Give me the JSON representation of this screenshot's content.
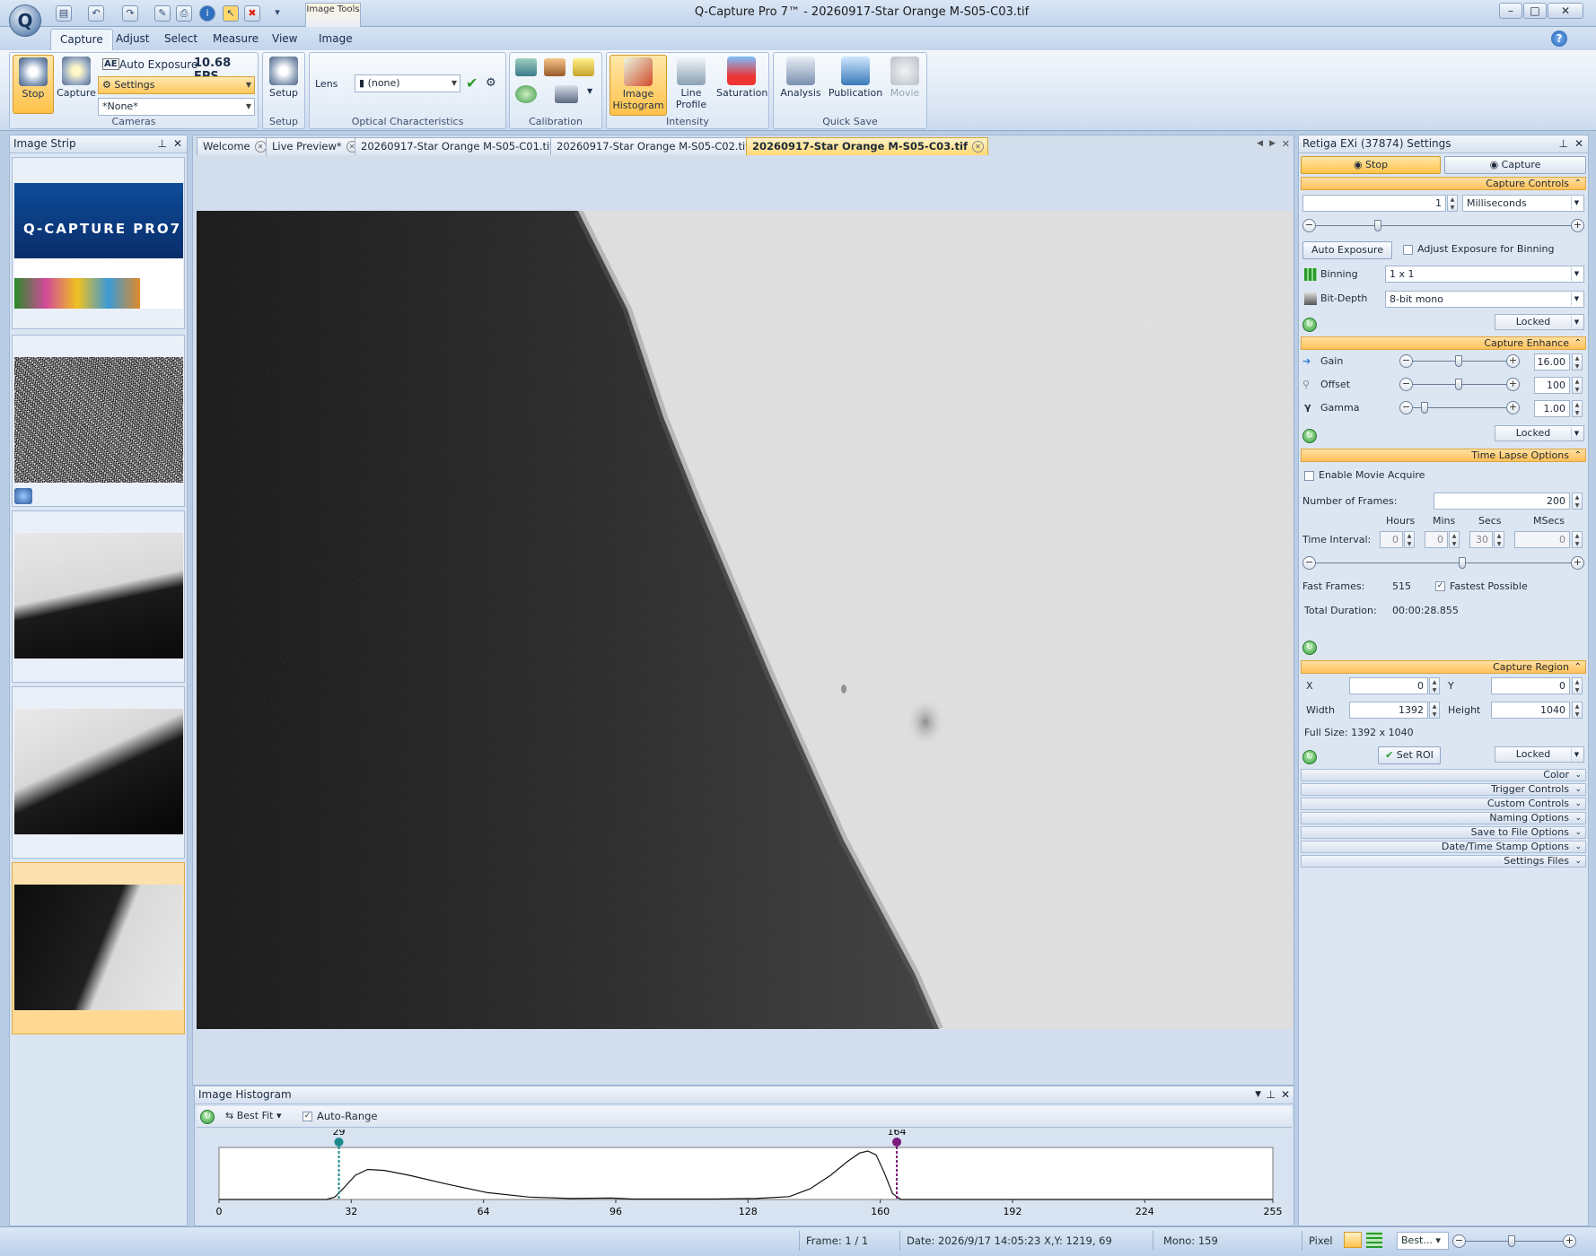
{
  "window": {
    "title": "Q-Capture Pro 7™ - 20260917-Star Orange M-S05-C03.tif",
    "context_tab": "Image Tools",
    "logo": "Q"
  },
  "ribbon_tabs": [
    "Capture",
    "Adjust",
    "Select",
    "Measure",
    "View",
    "Image"
  ],
  "ribbon": {
    "cameras": {
      "stop": "Stop",
      "capture": "Capture",
      "auto_exposure": "Auto Exposure",
      "ae_badge": "AE",
      "fps": "10.68 FPS",
      "settings": "Settings",
      "preset": "*None*",
      "label": "Cameras"
    },
    "setup": {
      "button": "Setup",
      "label": "Setup"
    },
    "optical": {
      "lens_label": "Lens",
      "lens_value": "(none)",
      "label": "Optical Characteristics"
    },
    "calibration": {
      "label": "Calibration"
    },
    "intensity": {
      "histogram": "Image Histogram",
      "line_profile": "Line Profile",
      "saturation": "Saturation",
      "label": "Intensity"
    },
    "quicksave": {
      "analysis": "Analysis",
      "publication": "Publication",
      "movie": "Movie",
      "label": "Quick Save"
    }
  },
  "image_strip": {
    "title": "Image Strip",
    "splash_title": "Q-CAPTURE PRO7"
  },
  "doc_tabs": [
    {
      "label": "Welcome",
      "active": false
    },
    {
      "label": "Live Preview*",
      "active": false
    },
    {
      "label": "20260917-Star Orange M-S05-C01.tif",
      "active": false
    },
    {
      "label": "20260917-Star Orange M-S05-C02.tif",
      "active": false
    },
    {
      "label": "20260917-Star Orange M-S05-C03.tif",
      "active": true
    }
  ],
  "histogram": {
    "title": "Image Histogram",
    "best_fit": "Best Fit",
    "auto_range": "Auto-Range",
    "auto_range_checked": true,
    "low_marker": "29",
    "high_marker": "164",
    "low_color": "#1a8a8a",
    "high_color": "#7a1a7a"
  },
  "chart_data": {
    "type": "area",
    "xlim": [
      0,
      255
    ],
    "x_ticks": [
      0,
      32,
      64,
      96,
      128,
      160,
      192,
      224,
      255
    ],
    "x": [
      0,
      26,
      28,
      30,
      33,
      36,
      40,
      46,
      55,
      65,
      75,
      85,
      95,
      100,
      110,
      120,
      130,
      138,
      143,
      148,
      152,
      155,
      157,
      159,
      161,
      163,
      165,
      255
    ],
    "y": [
      0,
      0,
      0.05,
      0.22,
      0.5,
      0.62,
      0.6,
      0.5,
      0.32,
      0.14,
      0.05,
      0.02,
      0.03,
      0.01,
      0.01,
      0.01,
      0.02,
      0.06,
      0.22,
      0.5,
      0.78,
      0.96,
      1.0,
      0.92,
      0.55,
      0.12,
      0,
      0
    ],
    "markers": [
      29,
      164
    ]
  },
  "status": {
    "frame": "Frame: 1 / 1",
    "date": "Date: 2026/9/17 14:05:23",
    "xy": "X,Y: 1219,   69",
    "mono": "Mono:   159",
    "pixel": "Pixel",
    "zoom": "Best..."
  },
  "settings": {
    "title": "Retiga EXi (37874) Settings",
    "stop": "Stop",
    "capture": "Capture",
    "capture_controls": {
      "header": "Capture Controls",
      "exposure": "1",
      "unit": "Milliseconds",
      "auto_exposure": "Auto Exposure",
      "adjust_binning": "Adjust Exposure for Binning",
      "binning_label": "Binning",
      "binning": "1 x 1",
      "bitdepth_label": "Bit-Depth",
      "bitdepth": "8-bit mono",
      "locked": "Locked"
    },
    "enhance": {
      "header": "Capture Enhance",
      "gain_label": "Gain",
      "gain": "16.00",
      "offset_label": "Offset",
      "offset": "100",
      "gamma_label": "Gamma",
      "gamma": "1.00",
      "locked": "Locked"
    },
    "timelapse": {
      "header": "Time Lapse Options",
      "enable": "Enable Movie Acquire",
      "frames_label": "Number of  Frames:",
      "frames": "200",
      "hours": "Hours",
      "mins": "Mins",
      "secs": "Secs",
      "msecs": "MSecs",
      "interval_label": "Time Interval:",
      "h": "0",
      "m": "0",
      "s": "30",
      "ms": "0",
      "fast_label": "Fast Frames:",
      "fast": "515",
      "fastest": "Fastest Possible",
      "duration_label": "Total Duration:",
      "duration": "00:00:28.855"
    },
    "region": {
      "header": "Capture Region",
      "x_label": "X",
      "x": "0",
      "y_label": "Y",
      "y": "0",
      "w_label": "Width",
      "w": "1392",
      "h_label": "Height",
      "h": "1040",
      "full": "Full Size: 1392 x 1040",
      "set_roi": "Set ROI",
      "locked": "Locked"
    },
    "collapsed": [
      "Color",
      "Trigger Controls",
      "Custom Controls",
      "Naming Options",
      "Save to File Options",
      "Date/Time Stamp Options",
      "Settings Files"
    ]
  }
}
